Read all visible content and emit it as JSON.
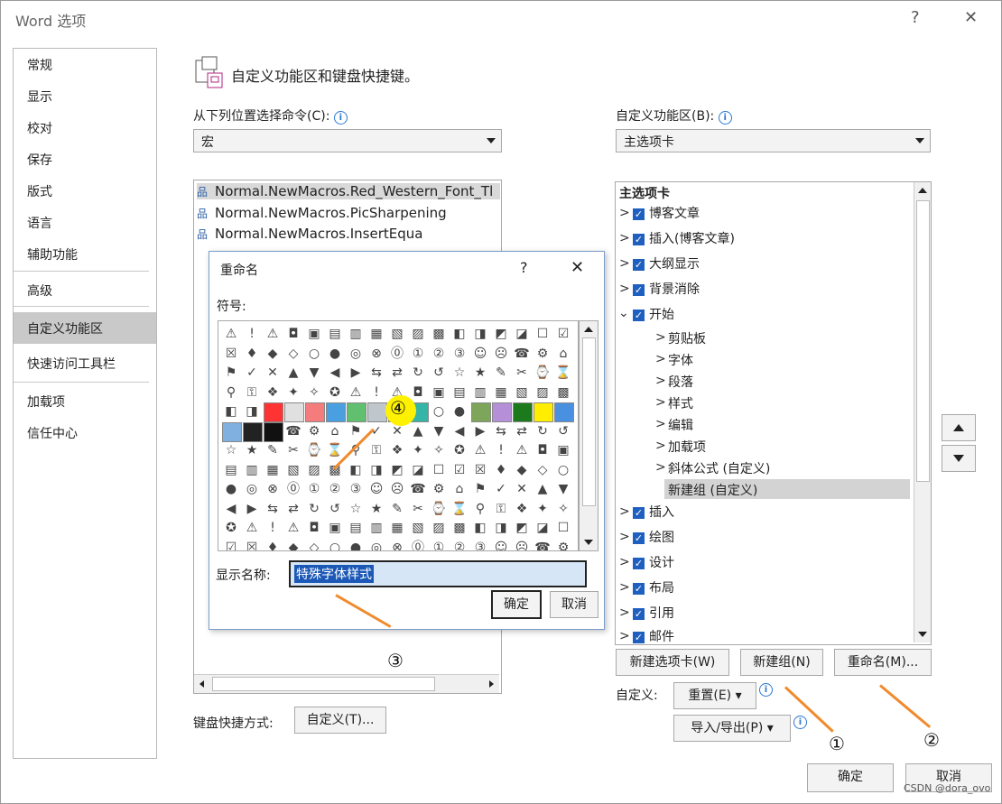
{
  "window": {
    "title": "Word 选项",
    "help": "?",
    "close": "✕"
  },
  "nav": {
    "items": [
      "常规",
      "显示",
      "校对",
      "保存",
      "版式",
      "语言",
      "辅助功能",
      "高级",
      "自定义功能区",
      "快速访问工具栏",
      "加载项",
      "信任中心"
    ],
    "selected": "自定义功能区"
  },
  "header": {
    "title": "自定义功能区和键盘快捷键。"
  },
  "left": {
    "label": "从下列位置选择命令(C):",
    "dropdown_value": "宏",
    "macros": [
      "Normal.NewMacros.Red_Western_Font_Tl",
      "Normal.NewMacros.PicSharpening",
      "Normal.NewMacros.InsertEqua"
    ],
    "keyboard_label": "键盘快捷方式:",
    "keyboard_button": "自定义(T)..."
  },
  "right": {
    "label": "自定义功能区(B):",
    "dropdown_value": "主选项卡",
    "tree_header": "主选项卡",
    "tabs_before": [
      {
        "label": "博客文章",
        "checked": true
      },
      {
        "label": "插入(博客文章)",
        "checked": true
      },
      {
        "label": "大纲显示",
        "checked": true
      },
      {
        "label": "背景消除",
        "checked": true
      },
      {
        "label": "开始",
        "checked": true
      }
    ],
    "groups": [
      "剪贴板",
      "字体",
      "段落",
      "样式",
      "编辑",
      "加载项",
      "斜体公式 (自定义)"
    ],
    "selected_group": "新建组 (自定义)",
    "tabs_after": [
      {
        "label": "插入",
        "checked": true
      },
      {
        "label": "绘图",
        "checked": true
      },
      {
        "label": "设计",
        "checked": true
      },
      {
        "label": "布局",
        "checked": true
      },
      {
        "label": "引用",
        "checked": true
      },
      {
        "label": "邮件",
        "checked": true
      }
    ],
    "buttons": {
      "new_tab": "新建选项卡(W)",
      "new_group": "新建组(N)",
      "rename": "重命名(M)..."
    },
    "customize_label": "自定义:",
    "reset_button": "重置(E) ▾",
    "import_export_button": "导入/导出(P) ▾"
  },
  "footer": {
    "ok": "确定",
    "cancel": "取消",
    "watermark": "CSDN @dora_ovo"
  },
  "dialog": {
    "title": "重命名",
    "help": "?",
    "close": "✕",
    "symbols_label": "符号:",
    "display_name_label": "显示名称:",
    "display_name_value": "特殊字体样式",
    "ok": "确定",
    "cancel": "取消"
  },
  "annotations": {
    "a1": "①",
    "a2": "②",
    "a3": "③",
    "a4": "④"
  },
  "colors": {
    "accent": "#f08a2c",
    "selection": "#c9c9c9",
    "checkbox": "#1f5fbf",
    "highlight": "#fff200"
  }
}
